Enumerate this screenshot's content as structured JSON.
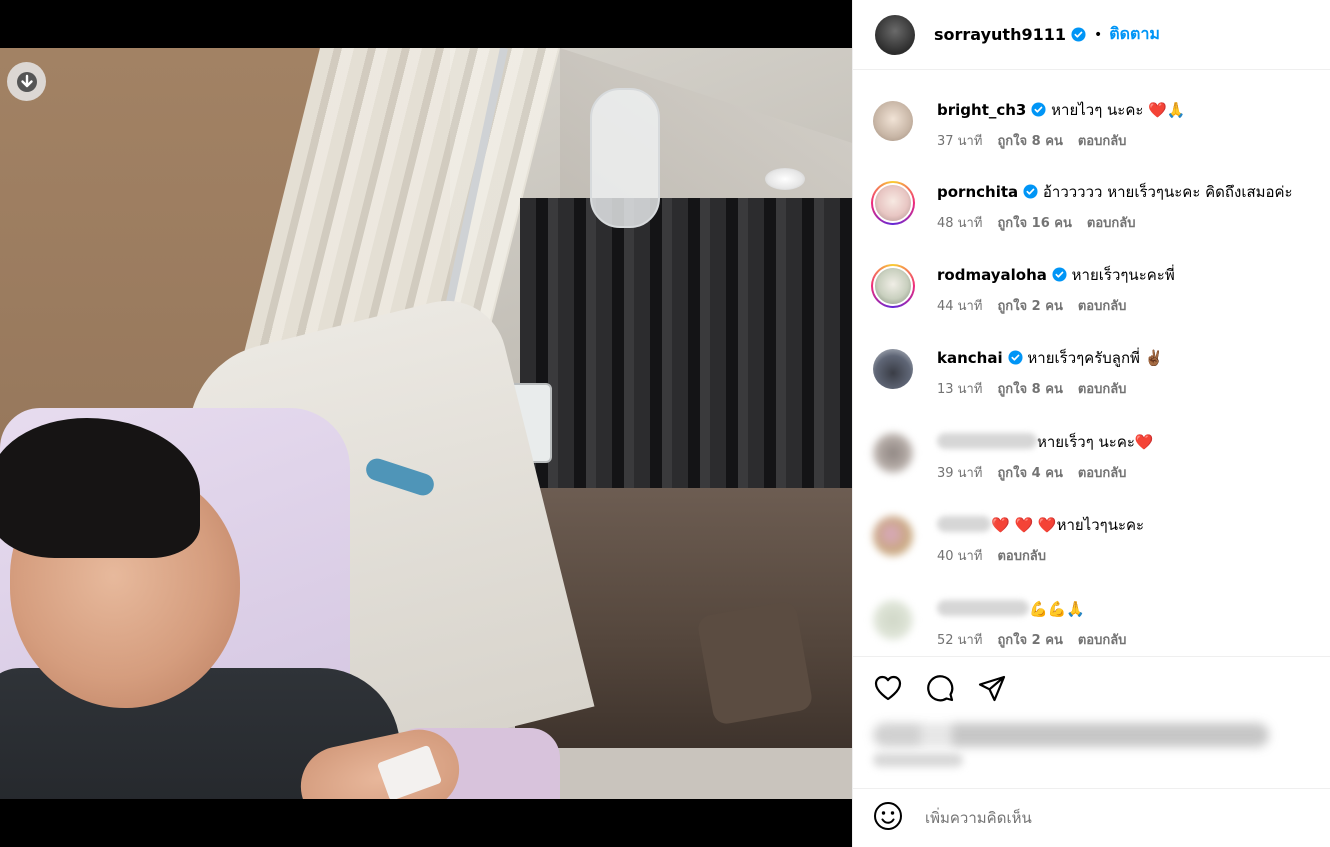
{
  "post": {
    "author": "sorrayuth9111",
    "follow_label": "ติดตาม",
    "separator": "•"
  },
  "comments": [
    {
      "user": "bright_ch3",
      "verified": true,
      "text": "หายไวๆ นะคะ ❤️🙏",
      "time": "37 นาที",
      "likes": "ถูกใจ 8 คน",
      "reply": "ตอบกลับ"
    },
    {
      "user": "pornchita",
      "verified": true,
      "text": "อ้าววววว หายเร็วๆนะคะ คิดถึงเสมอค่ะ",
      "time": "48 นาที",
      "likes": "ถูกใจ 16 คน",
      "reply": "ตอบกลับ"
    },
    {
      "user": "rodmayaloha",
      "verified": true,
      "text": "หายเร็วๆนะคะพี่",
      "time": "44 นาที",
      "likes": "ถูกใจ 2 คน",
      "reply": "ตอบกลับ"
    },
    {
      "user": "kanchai",
      "verified": true,
      "text": "หายเร็วๆครับลูกพี่ ✌🏾",
      "time": "13 นาที",
      "likes": "ถูกใจ 8 คน",
      "reply": "ตอบกลับ"
    },
    {
      "user": "",
      "verified": false,
      "text": "หายเร็วๆ นะคะ❤️",
      "time": "39 นาที",
      "likes": "ถูกใจ 4 คน",
      "reply": "ตอบกลับ"
    },
    {
      "user": "",
      "verified": false,
      "text": "❤️ ❤️ ❤️หายไวๆนะคะ",
      "time": "40 นาที",
      "likes": "",
      "reply": "ตอบกลับ"
    },
    {
      "user": "",
      "verified": false,
      "text": "💪💪🙏",
      "time": "52 นาที",
      "likes": "ถูกใจ 2 คน",
      "reply": "ตอบกลับ"
    }
  ],
  "composer": {
    "placeholder": "เพิ่มความคิดเห็น",
    "emoji_icon": "smiley-icon"
  },
  "icons": {
    "download": "download-arrow-icon",
    "like": "heart-icon",
    "comment": "comment-bubble-icon",
    "share": "paper-plane-icon"
  },
  "colors": {
    "accent": "#0095f6",
    "verified": "#0095f6",
    "meta_text": "#737373"
  }
}
